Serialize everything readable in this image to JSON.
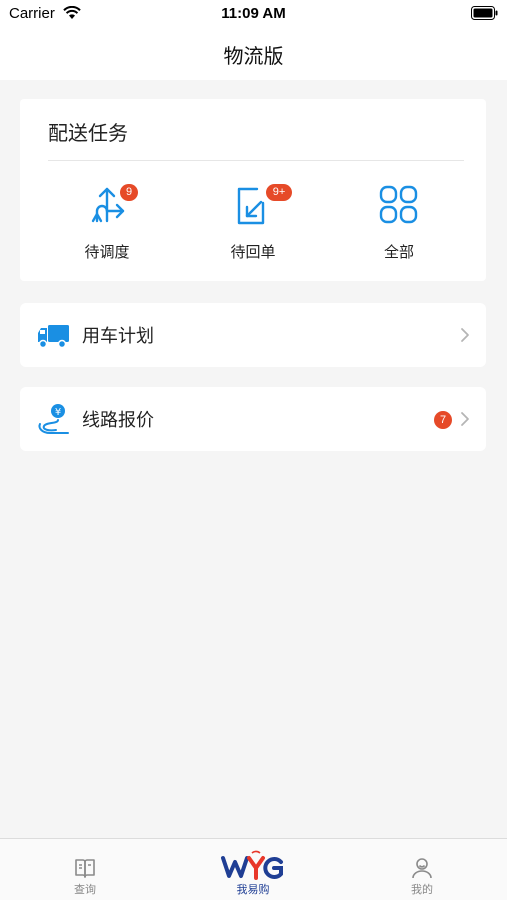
{
  "status_bar": {
    "carrier": "Carrier",
    "time": "11:09 AM"
  },
  "nav": {
    "title": "物流版"
  },
  "task_card": {
    "title": "配送任务",
    "items": [
      {
        "label": "待调度",
        "badge": "9",
        "icon": "dispatch-arrows-icon"
      },
      {
        "label": "待回单",
        "badge": "9+",
        "icon": "return-receipt-icon"
      },
      {
        "label": "全部",
        "badge": "",
        "icon": "grid-all-icon"
      }
    ]
  },
  "rows": [
    {
      "label": "用车计划",
      "icon": "truck-icon",
      "badge": ""
    },
    {
      "label": "线路报价",
      "icon": "route-price-icon",
      "badge": "7"
    }
  ],
  "tab_bar": {
    "items": [
      {
        "label": "查询",
        "icon": "book-icon"
      },
      {
        "label": "我易购",
        "icon": "wyg-logo"
      },
      {
        "label": "我的",
        "icon": "user-icon"
      }
    ],
    "active": "我易购"
  },
  "colors": {
    "accent": "#1a8fe3",
    "badge": "#e64a28",
    "brand": "#1f3e94",
    "background": "#f5f5f5"
  }
}
